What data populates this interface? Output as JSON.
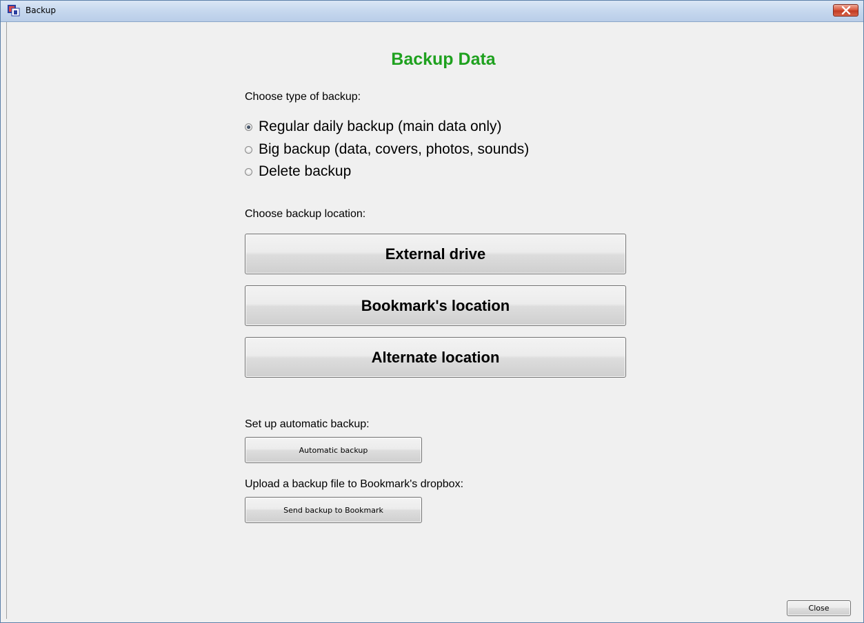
{
  "window": {
    "title": "Backup",
    "icon": "app-icon"
  },
  "main": {
    "heading": "Backup Data",
    "type_label": "Choose type of backup:",
    "backup_types": [
      {
        "label": "Regular daily backup (main data only)",
        "checked": true
      },
      {
        "label": "Big backup (data, covers, photos, sounds)",
        "checked": false
      },
      {
        "label": "Delete backup",
        "checked": false
      }
    ],
    "location_label": "Choose backup location:",
    "locations": {
      "external": "External drive",
      "bookmark": "Bookmark's location",
      "alternate": "Alternate location"
    },
    "automatic_label": "Set up automatic backup:",
    "automatic_button": "Automatic backup",
    "upload_label": "Upload a backup file to Bookmark's dropbox:",
    "send_button": "Send backup to Bookmark",
    "close_button": "Close"
  },
  "colors": {
    "heading": "#1fa11f",
    "background": "#f0f0f0",
    "titlebar": "#c6d8ee",
    "close_button": "#d95a40"
  }
}
